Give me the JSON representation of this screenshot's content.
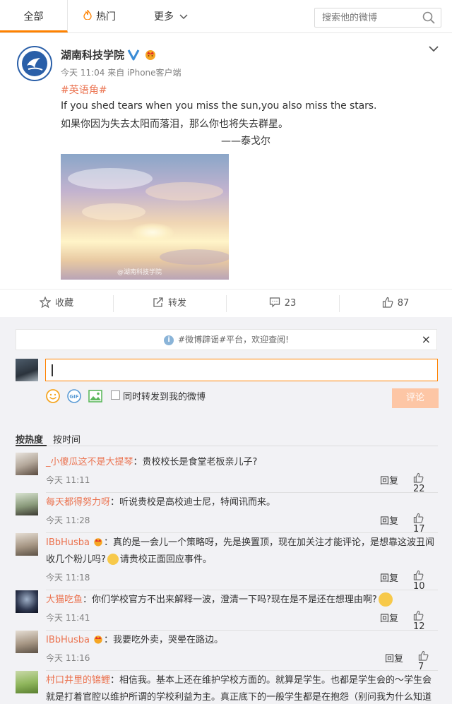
{
  "tabs": {
    "all": "全部",
    "hot": "热门",
    "more": "更多"
  },
  "search": {
    "placeholder": "搜索他的微博"
  },
  "post": {
    "author": "湖南科技学院",
    "meta": "今天 11:04 来自 iPhone客户端",
    "hashtag": "#英语角#",
    "line1": "If you shed tears when you miss the sun,you also miss the stars.",
    "line2": "如果你因为失去太阳而落泪，那么你也将失去群星。",
    "line3": "——泰戈尔",
    "image_watermark": "@湖南科技学院"
  },
  "actions": {
    "favorite": "收藏",
    "repost": "转发",
    "comment": "23",
    "like": "87"
  },
  "notice": "#微博辟谣#平台，欢迎查阅!",
  "composer": {
    "repost_label": "同时转发到我的微博",
    "submit": "评论"
  },
  "sort": {
    "hot": "按热度",
    "time": "按时间"
  },
  "comments": [
    {
      "name": "_小傻瓜这不是大提琴",
      "text": "：贵校校长是食堂老板亲儿子?",
      "time": "今天 11:11",
      "reply": "回复",
      "likes": "22"
    },
    {
      "name": "每天都得努力呀",
      "text": "：听说贵校是高校迪士尼，特闻讯而来。",
      "time": "今天 11:28",
      "reply": "回复",
      "likes": "17"
    },
    {
      "name": "IBbHusba",
      "text": "：真的是一会儿一个策略呀，先是换置顶，现在加关注才能评论，是想靠这波丑闻收几个粉儿吗?",
      "text2": "请贵校正面回应事件。",
      "time": "今天 11:18",
      "reply": "回复",
      "likes": "10"
    },
    {
      "name": "大猫吃鱼",
      "text": "：你们学校官方不出来解释一波，澄清一下吗?现在是不是还在想理由啊?",
      "time": "今天 11:41",
      "reply": "回复",
      "likes": "12"
    },
    {
      "name": "IBbHusba",
      "text": "：我要吃外卖，哭晕在路边。",
      "time": "今天 11:16",
      "reply": "回复",
      "likes": "7"
    },
    {
      "name": "村口井里的锦鲤",
      "text": "：相信我。基本上还在维护学校方面的。就算是学生。也都是学生会的～学生会就是打着官腔以维护所谓的学校利益为主。真正底下的一般学生都是在抱怨（别问我为什么知道～）"
    }
  ]
}
